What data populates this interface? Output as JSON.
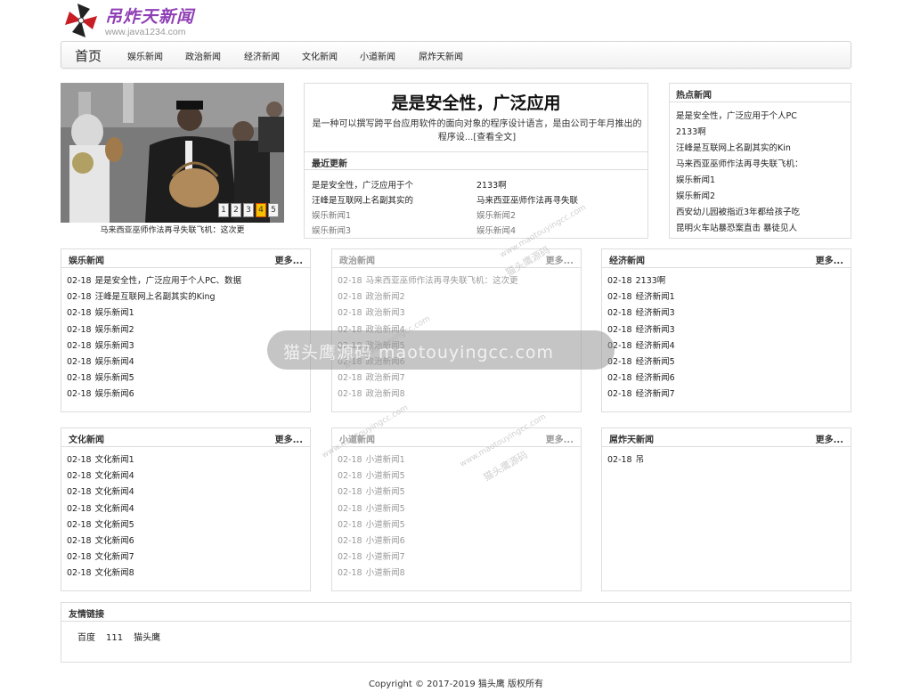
{
  "logo": {
    "title": "吊炸天新闻",
    "url": "www.java1234.com"
  },
  "nav": {
    "home": "首页",
    "items": [
      "娱乐新闻",
      "政治新闻",
      "经济新闻",
      "文化新闻",
      "小道新闻",
      "屌炸天新闻"
    ]
  },
  "slider": {
    "dots": [
      "1",
      "2",
      "3",
      "4",
      "5"
    ],
    "active_dot": "4",
    "caption": "马来西亚巫师作法再寻失联飞机：这次更"
  },
  "feature": {
    "title": "是是安全性，广泛应用",
    "description": "是一种可以撰写跨平台应用软件的面向对象的程序设计语言，是由公司于年月推出的程序设...[查看全文]",
    "recent_heading": "最近更新",
    "recent": [
      "是是安全性，广泛应用于个",
      "2133啊",
      "汪峰是互联网上名副其实的",
      "马来西亚巫师作法再寻失联",
      "娱乐新闻1",
      "娱乐新闻2",
      "娱乐新闻3",
      "娱乐新闻4"
    ]
  },
  "hot": {
    "heading": "热点新闻",
    "items": [
      "是是安全性，广泛应用于个人PC",
      "2133啊",
      "汪峰是互联网上名副其实的Kin",
      "马来西亚巫师作法再寻失联飞机：",
      "娱乐新闻1",
      "娱乐新闻2",
      "西安幼儿园被指近3年都给孩子吃",
      "昆明火车站暴恐案直击 暴徒见人"
    ]
  },
  "boxes": [
    {
      "title": "娱乐新闻",
      "more": "更多...",
      "rows": [
        {
          "date": "02-18",
          "text": "是是安全性，广泛应用于个人PC、数据"
        },
        {
          "date": "02-18",
          "text": "汪峰是互联网上名副其实的King"
        },
        {
          "date": "02-18",
          "text": "娱乐新闻1"
        },
        {
          "date": "02-18",
          "text": "娱乐新闻2"
        },
        {
          "date": "02-18",
          "text": "娱乐新闻3"
        },
        {
          "date": "02-18",
          "text": "娱乐新闻4"
        },
        {
          "date": "02-18",
          "text": "娱乐新闻5"
        },
        {
          "date": "02-18",
          "text": "娱乐新闻6"
        }
      ]
    },
    {
      "title": "政治新闻",
      "more": "更多...",
      "rows": [
        {
          "date": "02-18",
          "text": "马来西亚巫师作法再寻失联飞机：这次更"
        },
        {
          "date": "02-18",
          "text": "政治新闻2"
        },
        {
          "date": "02-18",
          "text": "政治新闻3"
        },
        {
          "date": "02-18",
          "text": "政治新闻4"
        },
        {
          "date": "02-18",
          "text": "政治新闻5"
        },
        {
          "date": "02-18",
          "text": "政治新闻6"
        },
        {
          "date": "02-18",
          "text": "政治新闻7"
        },
        {
          "date": "02-18",
          "text": "政治新闻8"
        }
      ]
    },
    {
      "title": "经济新闻",
      "more": "更多...",
      "rows": [
        {
          "date": "02-18",
          "text": "2133啊"
        },
        {
          "date": "02-18",
          "text": "经济新闻1"
        },
        {
          "date": "02-18",
          "text": "经济新闻3"
        },
        {
          "date": "02-18",
          "text": "经济新闻3"
        },
        {
          "date": "02-18",
          "text": "经济新闻4"
        },
        {
          "date": "02-18",
          "text": "经济新闻5"
        },
        {
          "date": "02-18",
          "text": "经济新闻6"
        },
        {
          "date": "02-18",
          "text": "经济新闻7"
        }
      ]
    },
    {
      "title": "文化新闻",
      "more": "更多...",
      "rows": [
        {
          "date": "02-18",
          "text": "文化新闻1"
        },
        {
          "date": "02-18",
          "text": "文化新闻4"
        },
        {
          "date": "02-18",
          "text": "文化新闻4"
        },
        {
          "date": "02-18",
          "text": "文化新闻4"
        },
        {
          "date": "02-18",
          "text": "文化新闻5"
        },
        {
          "date": "02-18",
          "text": "文化新闻6"
        },
        {
          "date": "02-18",
          "text": "文化新闻7"
        },
        {
          "date": "02-18",
          "text": "文化新闻8"
        }
      ]
    },
    {
      "title": "小道新闻",
      "more": "更多...",
      "rows": [
        {
          "date": "02-18",
          "text": "小道新闻1"
        },
        {
          "date": "02-18",
          "text": "小道新闻5"
        },
        {
          "date": "02-18",
          "text": "小道新闻5"
        },
        {
          "date": "02-18",
          "text": "小道新闻5"
        },
        {
          "date": "02-18",
          "text": "小道新闻5"
        },
        {
          "date": "02-18",
          "text": "小道新闻6"
        },
        {
          "date": "02-18",
          "text": "小道新闻7"
        },
        {
          "date": "02-18",
          "text": "小道新闻8"
        }
      ]
    },
    {
      "title": "屌炸天新闻",
      "more": "更多...",
      "rows": [
        {
          "date": "02-18",
          "text": "吊"
        }
      ]
    }
  ],
  "links": {
    "heading": "友情链接",
    "items": [
      "百度",
      "111",
      "猫头鹰"
    ]
  },
  "footer": "Copyright © 2017-2019 猫头鹰 版权所有",
  "watermark": {
    "band_text": "猫头鹰源码 maotouyingcc.com",
    "diag_url": "www.maotouyingcc.com",
    "diag_cn": "猫头鹰源码"
  },
  "colors": {
    "logo_purple": "#8f3fb5",
    "active_dot": "#f5c100",
    "border": "#dddddd"
  }
}
